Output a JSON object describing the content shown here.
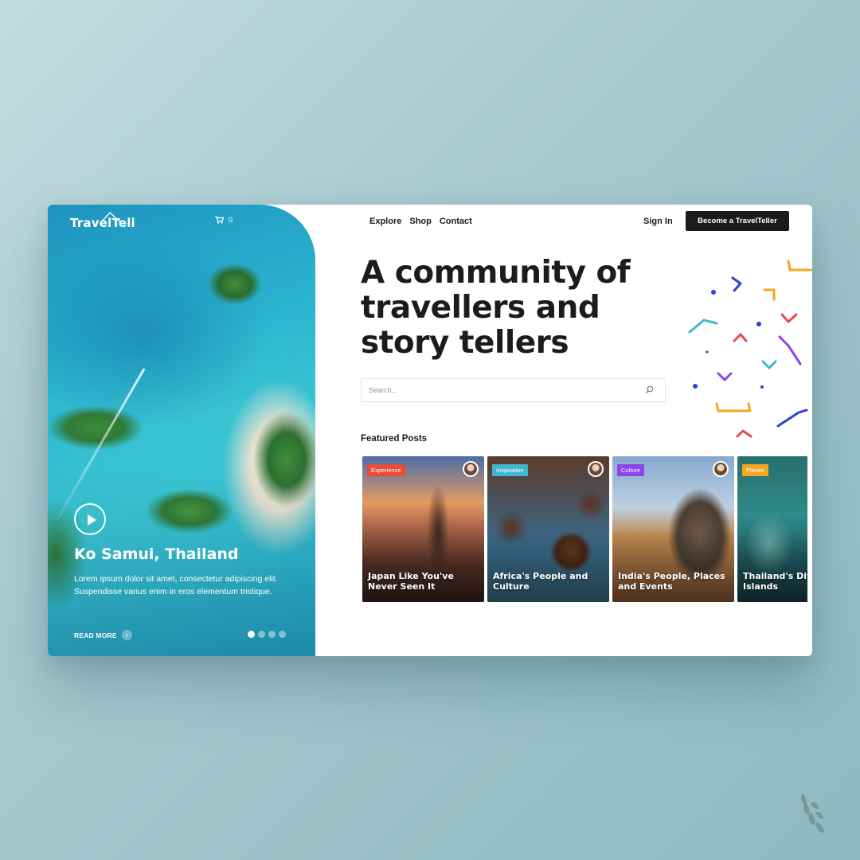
{
  "brand": {
    "name": "TravelTell"
  },
  "cart": {
    "count": "0"
  },
  "nav": {
    "items": [
      "Explore",
      "Shop",
      "Contact"
    ],
    "sign_in": "Sign In",
    "cta": "Become a TravelTeller"
  },
  "hero": {
    "title": "Ko Samui, Thailand",
    "description": "Lorem ipsum dolor sit amet, consectetur adipiscing elit. Suspendisse varius enim in eros elementum tristique.",
    "read_more": "READ MORE",
    "slides_count": 4,
    "active_slide": 1
  },
  "main": {
    "headline": "A community of travellers and story tellers",
    "search": {
      "placeholder": "Search..."
    },
    "featured_title": "Featured Posts",
    "posts": [
      {
        "tag": "Experience",
        "tag_color": "#e74c3c",
        "title": "Japan Like You've Never Seen It"
      },
      {
        "tag": "Inspiration",
        "tag_color": "#3fb7cf",
        "title": "Africa's People and Culture"
      },
      {
        "tag": "Culture",
        "tag_color": "#8e44ec",
        "title": "India's People, Places and Events"
      },
      {
        "tag": "Places",
        "tag_color": "#f5a623",
        "title": "Thailand's Diverse Islands"
      }
    ]
  },
  "colors": {
    "accent_dark": "#1b1b1b",
    "confetti": [
      "#f5a623",
      "#2d3fd9",
      "#e84a4a",
      "#3fb7cf",
      "#8e44ec"
    ]
  }
}
